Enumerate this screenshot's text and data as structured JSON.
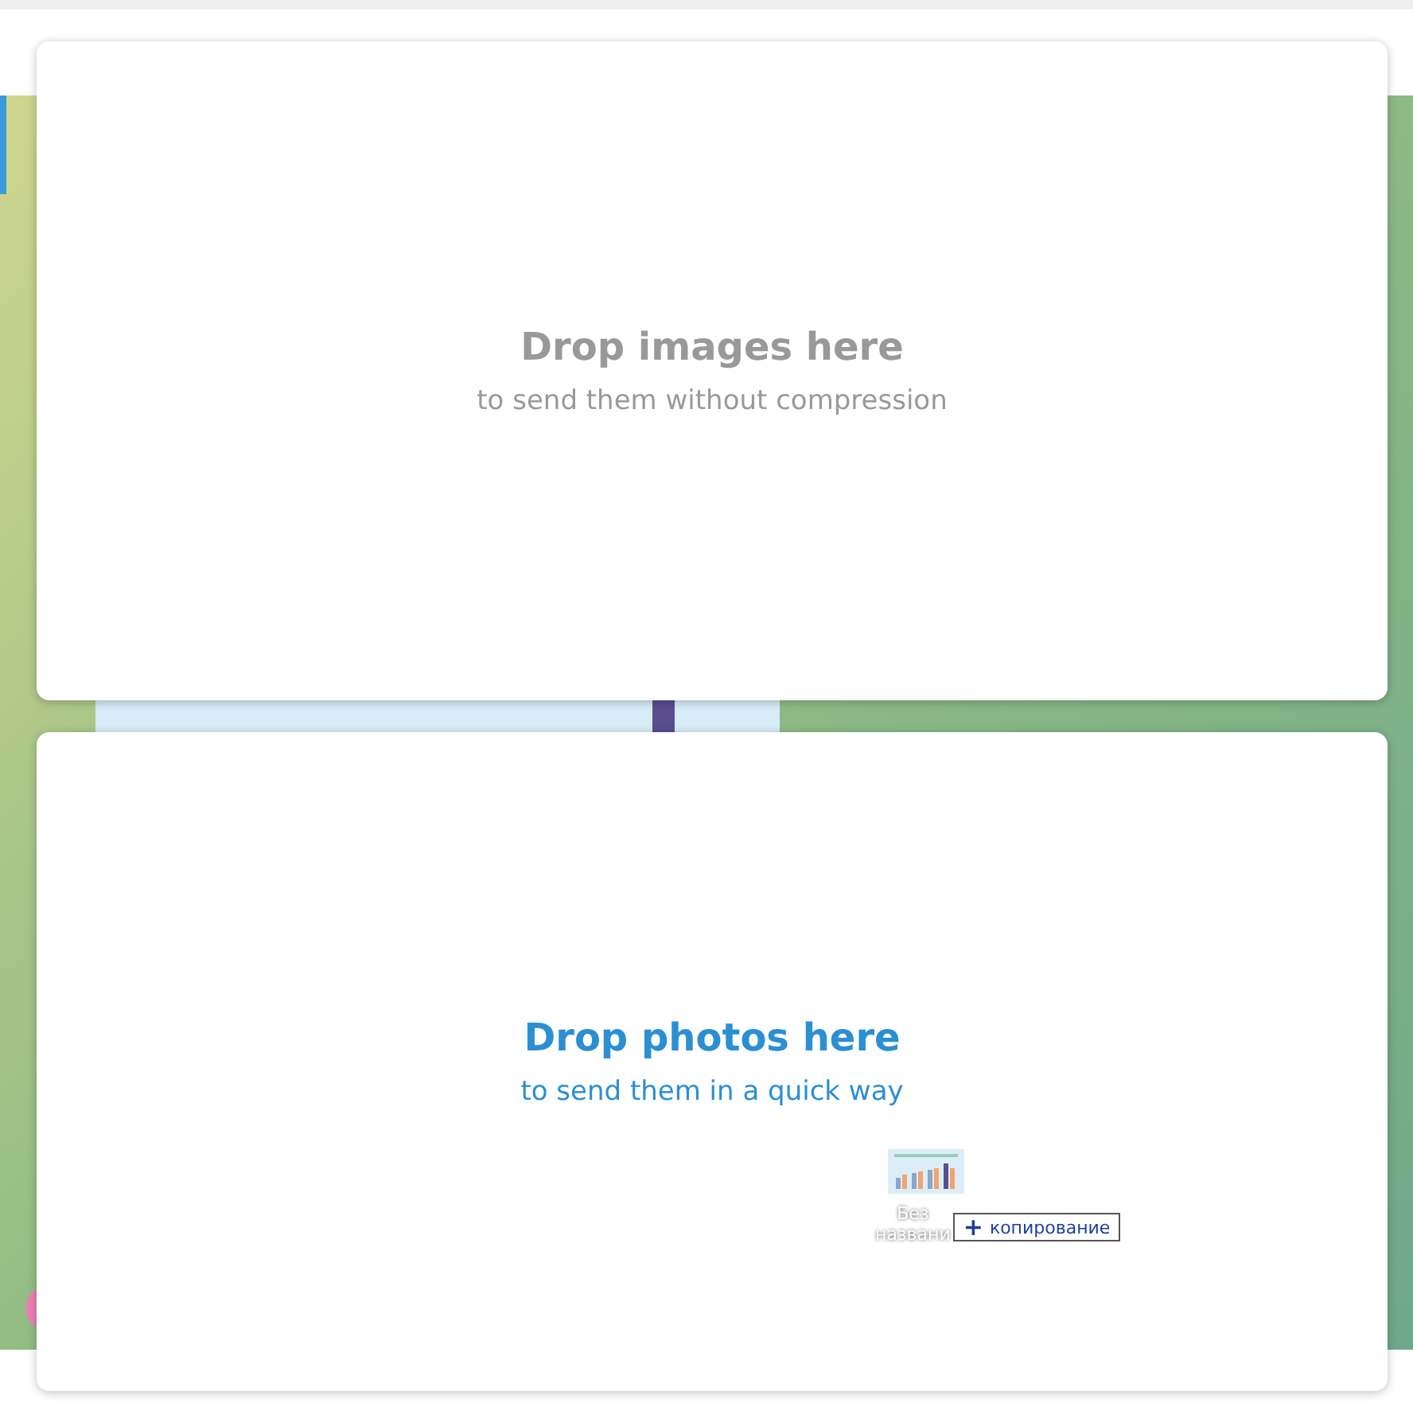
{
  "drop_zones": [
    {
      "title": "Drop images here",
      "subtitle": "to send them without compression",
      "selected": false
    },
    {
      "title": "Drop photos here",
      "subtitle": "to send them in a quick way",
      "selected": true
    }
  ],
  "drag_item": {
    "kind": "picture",
    "file_name_lines": [
      "Без",
      "названи"
    ],
    "action_icon": "+",
    "action": "копирование"
  }
}
